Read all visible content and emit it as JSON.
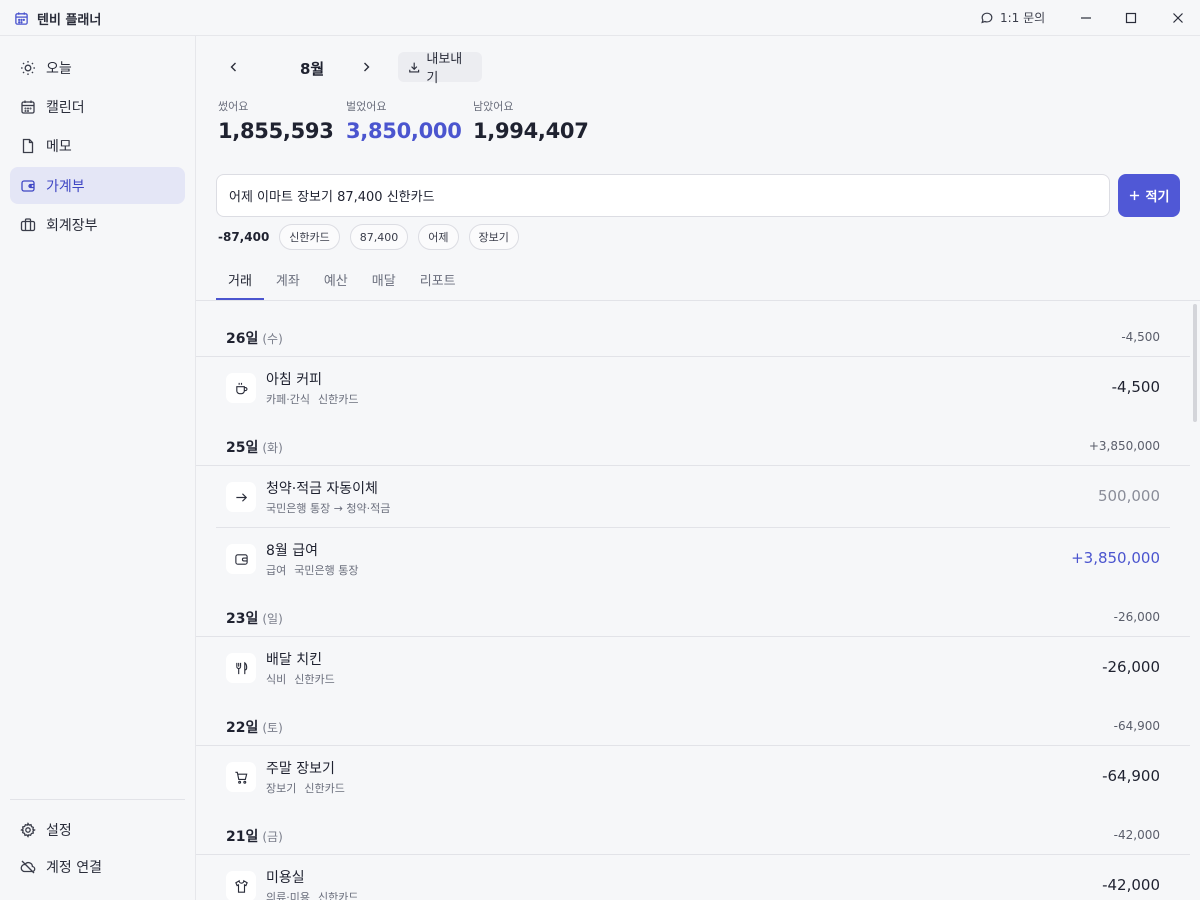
{
  "window": {
    "title": "텐비 플래너",
    "inquiry_label": "1:1 문의"
  },
  "sidebar": {
    "items": [
      {
        "label": "오늘",
        "icon": "sun-icon"
      },
      {
        "label": "캘린더",
        "icon": "calendar-icon"
      },
      {
        "label": "메모",
        "icon": "document-icon"
      },
      {
        "label": "가계부",
        "icon": "wallet-icon",
        "active": true
      },
      {
        "label": "회계장부",
        "icon": "briefcase-icon"
      }
    ],
    "bottom": [
      {
        "label": "설정",
        "icon": "gear-icon"
      },
      {
        "label": "계정 연결",
        "icon": "cloud-off-icon"
      }
    ]
  },
  "header": {
    "month": "8월",
    "export_label": "내보내기"
  },
  "summary": {
    "spent_label": "썼어요",
    "spent": "1,855,593",
    "earned_label": "벌었어요",
    "earned": "3,850,000",
    "left_label": "남았어요",
    "left": "1,994,407"
  },
  "quick_entry": {
    "value": "어제 이마트 장보기 87,400 신한카드",
    "submit_label": "적기",
    "parsed_amount": "-87,400",
    "chips": [
      "신한카드",
      "87,400",
      "어제",
      "장보기"
    ]
  },
  "tabs": [
    "거래",
    "계좌",
    "예산",
    "매달",
    "리포트"
  ],
  "days": [
    {
      "day": "26일",
      "dow": "(수)",
      "total": "-4,500",
      "transactions": [
        {
          "title": "아침 커피",
          "category": "카페·간식",
          "account": "신한카드",
          "amount": "-4,500",
          "kind": "expense",
          "icon": "coffee-cup-icon"
        }
      ]
    },
    {
      "day": "25일",
      "dow": "(화)",
      "total": "+3,850,000",
      "transactions": [
        {
          "title": "청약·적금 자동이체",
          "category": "국민은행 통장 → 청약·적금",
          "account": "",
          "amount": "500,000",
          "kind": "transfer",
          "icon": "arrow-right-icon"
        },
        {
          "title": "8월 급여",
          "category": "급여",
          "account": "국민은행 통장",
          "amount": "+3,850,000",
          "kind": "income",
          "icon": "wallet-icon"
        }
      ]
    },
    {
      "day": "23일",
      "dow": "(일)",
      "total": "-26,000",
      "transactions": [
        {
          "title": "배달 치킨",
          "category": "식비",
          "account": "신한카드",
          "amount": "-26,000",
          "kind": "expense",
          "icon": "utensils-icon"
        }
      ]
    },
    {
      "day": "22일",
      "dow": "(토)",
      "total": "-64,900",
      "transactions": [
        {
          "title": "주말 장보기",
          "category": "장보기",
          "account": "신한카드",
          "amount": "-64,900",
          "kind": "expense",
          "icon": "cart-icon"
        }
      ]
    },
    {
      "day": "21일",
      "dow": "(금)",
      "total": "-42,000",
      "transactions": [
        {
          "title": "미용실",
          "category": "의류·미용",
          "account": "신한카드",
          "amount": "-42,000",
          "kind": "expense",
          "icon": "shirt-icon"
        }
      ]
    }
  ],
  "colors": {
    "accent": "#5058d6",
    "income": "#4b55cf",
    "active_nav_bg": "#e4e6f6",
    "background": "#f6f7f9"
  }
}
